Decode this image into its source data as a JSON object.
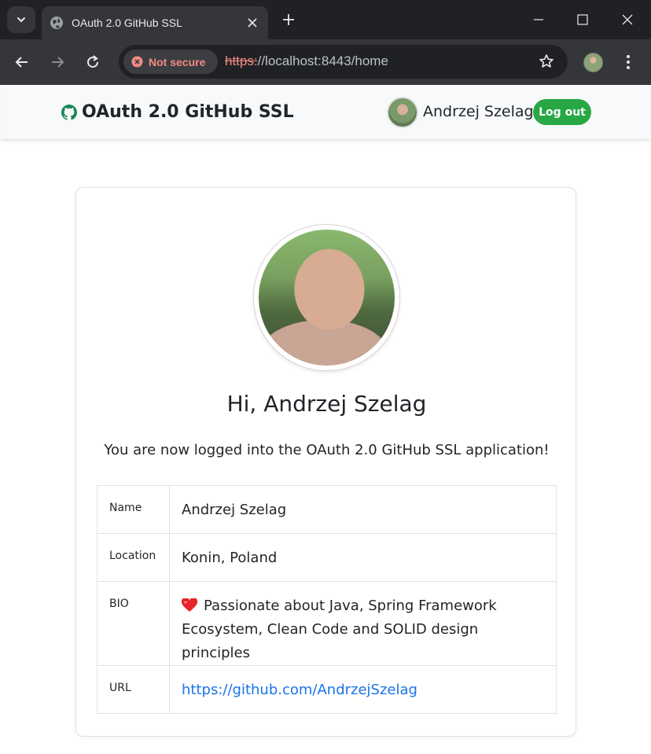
{
  "browser": {
    "tab_title": "OAuth 2.0 GitHub SSL",
    "security_chip": "Not secure",
    "url_scheme": "https:",
    "url_rest": "//localhost:8443/home"
  },
  "navbar": {
    "brand": "OAuth 2.0 GitHub SSL",
    "user_name": "Andrzej Szelag",
    "logout_label": "Log out"
  },
  "card": {
    "greeting": "Hi, Andrzej Szelag",
    "message": "You are now logged into the OAuth 2.0 GitHub SSL application!",
    "rows": [
      {
        "label": "Name",
        "value": "Andrzej Szelag"
      },
      {
        "label": "Location",
        "value": "Konin, Poland"
      },
      {
        "label": "BIO",
        "value": "Passionate about Java, Spring Framework Ecosystem, Clean Code and SOLID design principles"
      },
      {
        "label": "URL",
        "value": "https://github.com/AndrzejSzelag"
      }
    ]
  },
  "colors": {
    "accent_green": "#28a745",
    "link_blue": "#1a73e8",
    "insecure_red": "#f28b82"
  }
}
